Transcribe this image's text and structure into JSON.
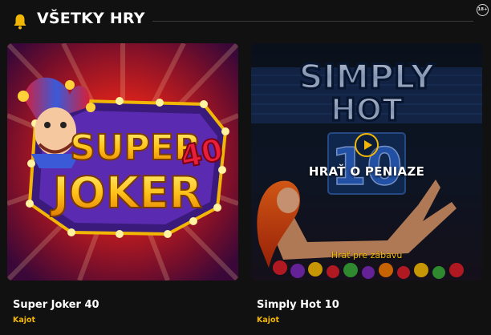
{
  "header": {
    "title": "VŠETKY HRY",
    "age_badge": "18+",
    "icon": "bell-icon"
  },
  "colors": {
    "accent": "#f2b705",
    "background": "#111111",
    "text": "#ffffff"
  },
  "games": [
    {
      "title": "Super Joker 40",
      "provider": "Kajot",
      "logo_lines": [
        "SUPER",
        "JOKER",
        "40"
      ]
    },
    {
      "title": "Simply Hot 10",
      "provider": "Kajot",
      "logo_lines": [
        "SIMPLY",
        "HOT",
        "10"
      ],
      "hover": {
        "play_money_label": "HRAŤ O PENIAZE",
        "play_fun_label": "Hrať pre zábavu",
        "play_icon": "play-icon"
      }
    }
  ]
}
